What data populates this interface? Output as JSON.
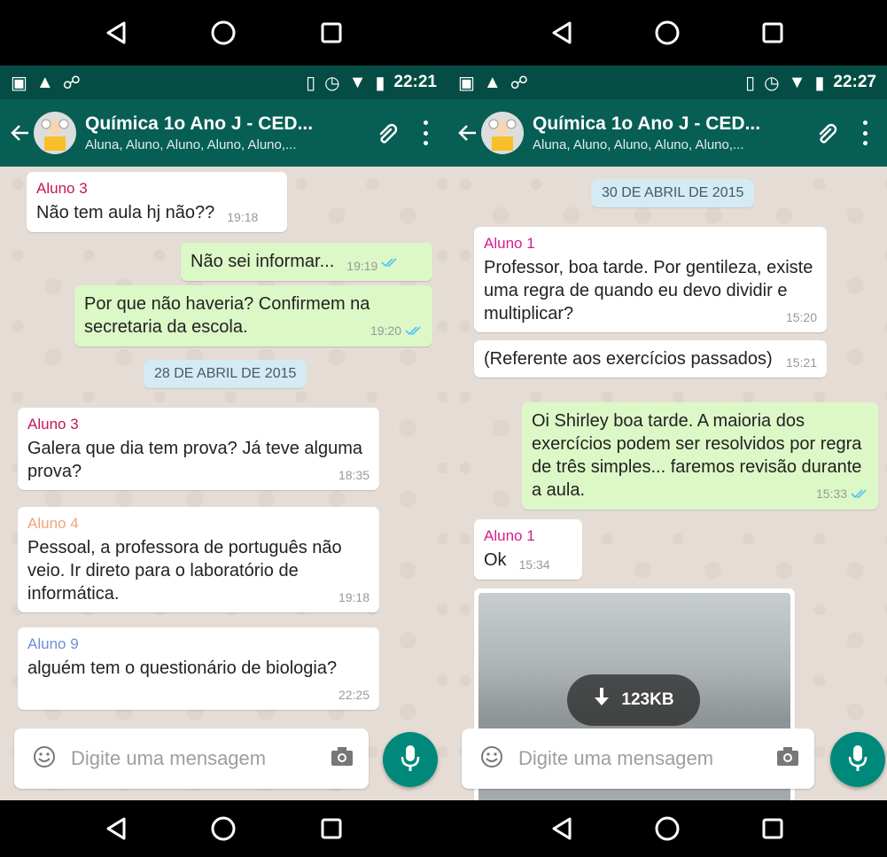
{
  "left": {
    "status": {
      "time": "22:21"
    },
    "header": {
      "title": "Química 1o Ano J - CED...",
      "subtitle": "Aluna, Aluno, Aluno, Aluno, Aluno,..."
    },
    "messages": [
      {
        "sender": "Aluno 3",
        "text": "Não tem aula hj não??",
        "time": "19:18"
      },
      {
        "text": "Não sei informar...",
        "time": "19:19"
      },
      {
        "text": "Por que não haveria? Confirmem na secretaria da escola.",
        "time": "19:20"
      },
      {
        "sender": "Aluno 3",
        "text": "Galera que dia tem prova?  Já teve alguma prova?",
        "time": "18:35"
      },
      {
        "sender": "Aluno 4",
        "text": "Pessoal, a professora de português não veio. Ir direto para o laboratório de informática.",
        "time": "19:18"
      },
      {
        "sender": "Aluno 9",
        "text": "alguém tem o questionário de biologia?",
        "time": "22:25"
      }
    ],
    "date_chip": "28 DE ABRIL DE 2015",
    "input_placeholder": "Digite uma mensagem"
  },
  "right": {
    "status": {
      "time": "22:27"
    },
    "header": {
      "title": "Química 1o Ano J - CED...",
      "subtitle": "Aluna, Aluno, Aluno, Aluno, Aluno,..."
    },
    "date_chip": "30 DE ABRIL DE 2015",
    "messages": [
      {
        "sender": "Aluno 1",
        "text": "Professor, boa tarde. Por gentileza, existe uma regra de quando eu devo dividir e multiplicar?",
        "time": "15:20"
      },
      {
        "text": "(Referente aos exercícios passados)",
        "time": "15:21"
      },
      {
        "text": "Oi Shirley boa tarde. A maioria dos exercícios podem ser resolvidos por regra de três simples... faremos revisão durante a aula.",
        "time": "15:33"
      },
      {
        "sender": "Aluno 1",
        "text": "Ok",
        "time": "15:34"
      }
    ],
    "media": {
      "size": "123KB"
    },
    "input_placeholder": "Digite uma mensagem"
  },
  "colors": {
    "appbar": "#075e54",
    "statusbar": "#054d44",
    "outgoing": "#dcf8c6",
    "incoming": "#ffffff",
    "sender_aluno3": "#c2185b",
    "sender_aluno4": "#f4a27b",
    "sender_aluno9": "#6d8fd8",
    "sender_aluno1": "#d81b8c",
    "read_ticks": "#4fc3f7",
    "mic": "#00897b"
  },
  "icons": [
    "back-icon",
    "home-icon",
    "recents-icon",
    "arrow-back-icon",
    "paperclip-icon",
    "more-vert-icon",
    "emoji-icon",
    "camera-icon",
    "mic-icon",
    "double-check-icon",
    "download-icon"
  ]
}
